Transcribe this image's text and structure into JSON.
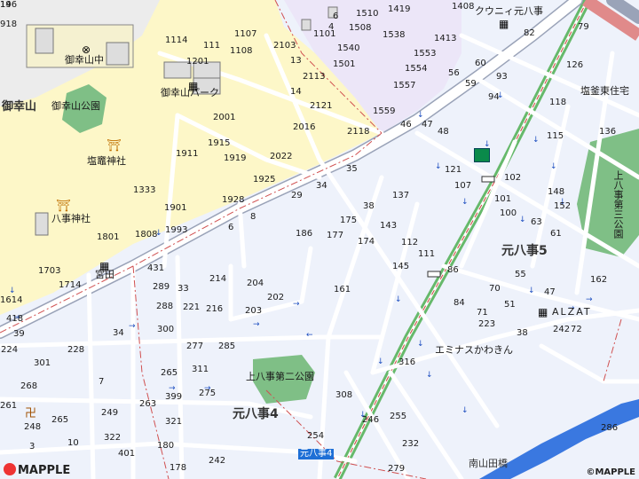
{
  "map": {
    "colors": {
      "residential": "#eef2fb",
      "hill": "#fdf7c8",
      "purple_zone": "#ece6f8",
      "park": "#7fbf86",
      "road": "#ffffff",
      "railway": "#66b96b",
      "river": "#3a78e0",
      "road_outline": "#9aa3b8"
    },
    "places": {
      "okoyama_ch": "御幸山中",
      "okoyama": "御幸山",
      "okoyama_park": "御幸山公園",
      "okoyama_park2": "御幸山パーク",
      "shiogama_shrine": "塩竈神社",
      "hachiji_shrine": "八事神社",
      "miyata": "宮田",
      "cuore": "クウニィ元八事",
      "shiogama_housing": "塩釜東住宅",
      "kamiyagoto_park3": "上八事第三公園",
      "motoyagoto5": "元八事5",
      "alzat": "ALZAT",
      "eminas": "エミナスかわきん",
      "kamiyagoto_park2": "上八事第二公園",
      "motoyagoto4": "元八事4",
      "motoyagoto4_bottom": "元八事4",
      "minami_yamabashi": "南山田橋"
    },
    "branding": {
      "brand": "MAPPLE",
      "copyright": "©MAPPLE"
    },
    "block_numbers": [
      "918",
      "1114",
      "111",
      "1107",
      "2103",
      "6",
      "1101",
      "4",
      "1510",
      "1419",
      "1408",
      "1508",
      "1538",
      "82",
      "79",
      "1413",
      "1201",
      "1108",
      "13",
      "1540",
      "1501",
      "1553",
      "60",
      "126",
      "1554",
      "56",
      "93",
      "2113",
      "1557",
      "59",
      "14",
      "2121",
      "1559",
      "94",
      "118",
      "2001",
      "2016",
      "2118",
      "46",
      "47",
      "48",
      "115",
      "136",
      "1915",
      "1911",
      "1919",
      "2022",
      "35",
      "121",
      "102",
      "1925",
      "29",
      "34",
      "107",
      "137",
      "148",
      "1333",
      "101",
      "152",
      "1928",
      "38",
      "100",
      "8",
      "1901",
      "175",
      "143",
      "63",
      "1993",
      "6",
      "186",
      "177",
      "174",
      "112",
      "61",
      "1801",
      "1808",
      "111",
      "1703",
      "431",
      "145",
      "86",
      "55",
      "1714",
      "289",
      "33",
      "214",
      "204",
      "202",
      "162",
      "1614",
      "84",
      "70",
      "47",
      "161",
      "288",
      "221",
      "216",
      "203",
      "71",
      "51",
      "418",
      "223",
      "242",
      "72",
      "38",
      "39",
      "34",
      "300",
      "277",
      "285",
      "224",
      "228",
      "301",
      "316",
      "311",
      "7",
      "265",
      "275",
      "268",
      "263",
      "399",
      "308",
      "261",
      "265",
      "249",
      "321",
      "255",
      "248",
      "10",
      "322",
      "180",
      "254",
      "246",
      "286",
      "3",
      "401",
      "178",
      "242",
      "232",
      "279",
      "14",
      "196"
    ]
  }
}
